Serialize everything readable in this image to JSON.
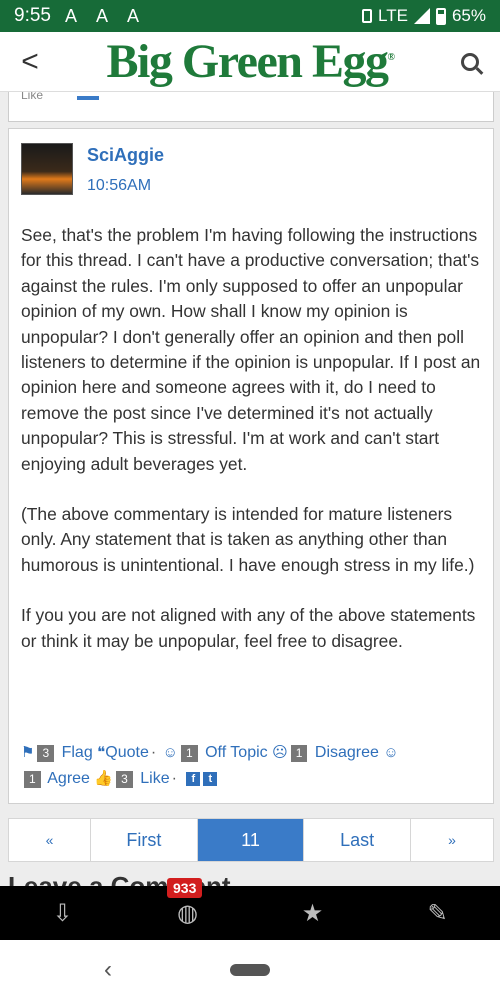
{
  "status_bar": {
    "time": "9:55",
    "text_icons": "A A A",
    "network": "LTE",
    "battery": "65%"
  },
  "header": {
    "back": "<",
    "logo": "Big Green Egg",
    "logo_mark": "®"
  },
  "prev_post": {
    "like_label": "Like"
  },
  "post": {
    "username": "SciAggie",
    "time": "10:56AM",
    "paragraphs": [
      "See, that's the problem I'm having following the instructions for this thread. I can't have a productive conversation; that's against the rules. I'm only supposed to offer an unpopular opinion of my own. How shall I know my opinion is unpopular? I don't generally offer an opinion and then poll listeners to determine if the opinion is unpopular. If I post an opinion here and someone agrees with it, do I need to remove the post since I've determined it's not actually unpopular? This is stressful. I'm at work and can't start enjoying adult beverages yet.",
      "(The above commentary is intended for mature listeners only. Any statement that is taken as anything other than humorous is unintentional. I have enough stress in my life.)",
      "If you you are not aligned with any of the above statements or think it may be unpopular, feel free to disagree."
    ],
    "actions": {
      "flag_count": "3",
      "flag_label": "Flag",
      "quote_label": "Quote",
      "offtopic_count": "1",
      "offtopic_label": "Off Topic",
      "disagree_count": "1",
      "disagree_label": "Disagree",
      "agree_count": "1",
      "agree_label": "Agree",
      "like_count": "3",
      "like_label": "Like"
    }
  },
  "pager": {
    "prev": "«",
    "first": "First",
    "current": "11",
    "last": "Last",
    "next": "»"
  },
  "leave_comment": "Leave a Comment",
  "bottom_bar": {
    "badge": "933"
  }
}
